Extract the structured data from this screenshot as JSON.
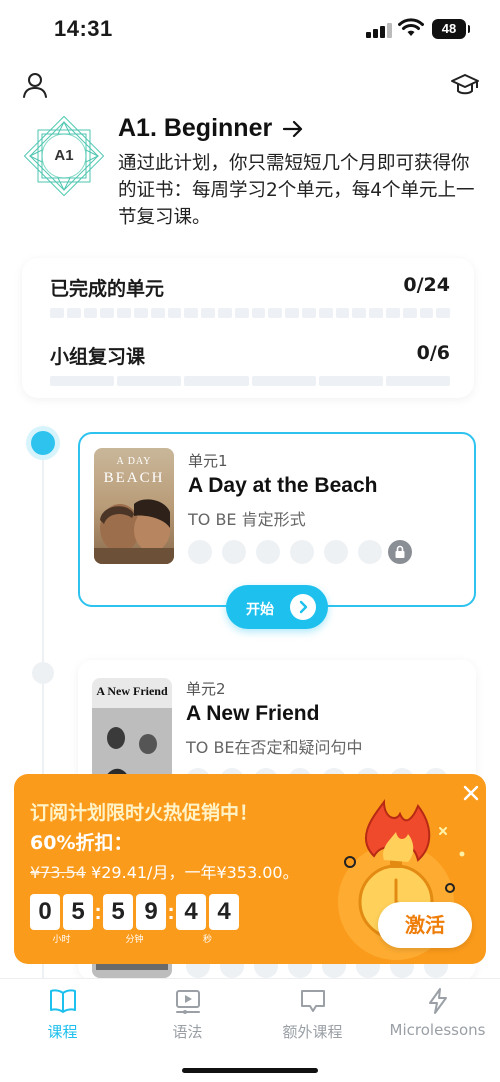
{
  "status_bar": {
    "time": "14:31",
    "battery": "48"
  },
  "level": {
    "badge": "A1",
    "title": "A1. Beginner",
    "description": "通过此计划，你只需短短几个月即可获得你的证书：每周学习2个单元，每4个单元上一节复习课。"
  },
  "progress": {
    "completed_units_label": "已完成的单元",
    "completed_units_value": "0/24",
    "completed_units_fraction": 0,
    "review_label": "小组复习课",
    "review_value": "0/6",
    "review_fraction": 0
  },
  "units": [
    {
      "number": "单元1",
      "title": "A Day at the Beach",
      "subtitle": "TO BE 肯定形式",
      "thumb_line1": "A DAY",
      "thumb_line2": "BEACH",
      "start_label": "开始",
      "state": "active"
    },
    {
      "number": "单元2",
      "title": "A New Friend",
      "subtitle": "TO BE在否定和疑问句中",
      "thumb_title": "A New Friend",
      "state": "upcoming"
    }
  ],
  "promo": {
    "title": "订阅计划限时火热促销中！",
    "discount": "60%折扣：",
    "old_price": "¥73.54",
    "new_price": " ¥29.41/月，一年¥353.00。",
    "countdown": {
      "hours": [
        "0",
        "5"
      ],
      "minutes": [
        "5",
        "9"
      ],
      "seconds": [
        "4",
        "4"
      ],
      "hours_label": "小时",
      "minutes_label": "分钟",
      "seconds_label": "秒"
    },
    "activate_label": "激活"
  },
  "tabs": [
    {
      "label": "课程",
      "icon": "book-icon",
      "active": true
    },
    {
      "label": "语法",
      "icon": "video-lesson-icon",
      "active": false
    },
    {
      "label": "额外课程",
      "icon": "chat-bubble-icon",
      "active": false
    },
    {
      "label": "Microlessons",
      "icon": "lightning-icon",
      "active": false
    }
  ],
  "colors": {
    "accent": "#1ec0ee",
    "promo": "#fb9b1b",
    "lock": "#8a8f96"
  }
}
